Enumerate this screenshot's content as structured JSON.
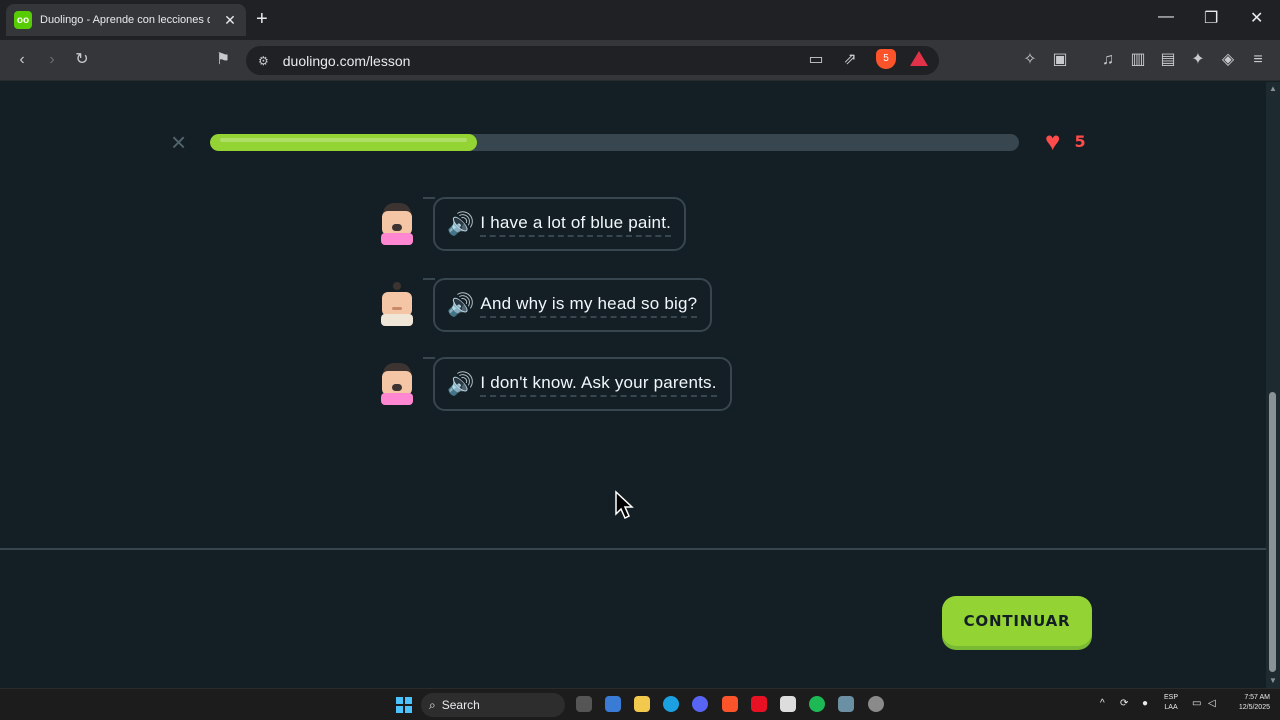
{
  "browser": {
    "tab_title": "Duolingo - Aprende con lecciones de inglés que",
    "favicon": "oo",
    "url": "duolingo.com/lesson",
    "shield_count": "5"
  },
  "lesson": {
    "progress_percent": 33,
    "hearts": "5",
    "dialogue": [
      {
        "speaker": "woman-with-mustache-avatar",
        "text": "I have a lot of blue paint."
      },
      {
        "speaker": "man-avatar",
        "text": "And why is my head so big?"
      },
      {
        "speaker": "woman-with-mustache-avatar",
        "text": "I don't know. Ask your parents."
      }
    ],
    "continue_label": "CONTINUAR"
  },
  "taskbar": {
    "search_label": "Search",
    "lang_top": "ESP",
    "lang_bottom": "LAA",
    "time": "7:57 AM",
    "date": "12/5/2025"
  },
  "colors": {
    "accent_green": "#93d333",
    "heart_red": "#ff4b4b",
    "speaker_blue": "#1cb0f6",
    "background": "#131f24"
  }
}
